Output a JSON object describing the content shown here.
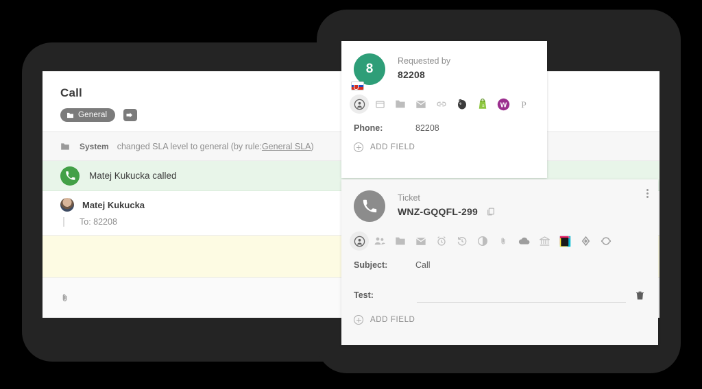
{
  "back_window": {
    "title": "Call",
    "tag": {
      "label": "General",
      "icon": "folder-icon"
    },
    "add_tag_icon": "add-tag-icon",
    "rows": {
      "system": {
        "icon": "note-icon",
        "who": "System",
        "text": "changed SLA level to general (by rule: ",
        "link": "General SLA",
        "text_end": ")"
      },
      "called": {
        "icon": "phone-icon",
        "text": "Matej Kukucka called"
      },
      "message": {
        "avatar": "user-avatar",
        "name": "Matej Kukucka",
        "to": "To: 82208"
      },
      "footer": {
        "icon": "paperclip-icon"
      }
    }
  },
  "requester_card": {
    "avatar": {
      "initial": "8",
      "color": "#2e9e78",
      "flag": "slovakia-flag-badge"
    },
    "label": "Requested by",
    "value": "82208",
    "icons": [
      {
        "name": "contact-icon",
        "active": true
      },
      {
        "name": "window-icon",
        "active": false
      },
      {
        "name": "folder-icon",
        "active": false
      },
      {
        "name": "envelope-icon",
        "active": false
      },
      {
        "name": "link-icon",
        "active": false
      },
      {
        "name": "mailchimp-icon",
        "active": false
      },
      {
        "name": "shopify-icon",
        "active": false
      },
      {
        "name": "woocommerce-icon",
        "active": false
      },
      {
        "name": "paypal-icon",
        "active": false
      }
    ],
    "fields": [
      {
        "key": "Phone:",
        "value": "82208"
      }
    ],
    "add_field": "ADD FIELD"
  },
  "ticket_card": {
    "avatar_icon": "phone-icon",
    "label": "Ticket",
    "id": "WNZ-GQQFL-299",
    "copy_icon": "copy-icon",
    "kebab_icon": "more-vertical-icon",
    "icons": [
      {
        "name": "contact-icon",
        "active": true
      },
      {
        "name": "group-icon",
        "active": false
      },
      {
        "name": "folder-icon",
        "active": false
      },
      {
        "name": "envelope-icon",
        "active": false
      },
      {
        "name": "alarm-icon",
        "active": false
      },
      {
        "name": "history-icon",
        "active": false
      },
      {
        "name": "clock-icon",
        "active": false
      },
      {
        "name": "paperclip-icon",
        "active": false
      },
      {
        "name": "cloud-icon",
        "active": false
      },
      {
        "name": "bank-icon",
        "active": false
      },
      {
        "name": "color-swatch-icon",
        "active": false
      },
      {
        "name": "diamond-icon",
        "active": false
      },
      {
        "name": "sync-icon",
        "active": false
      }
    ],
    "fields": [
      {
        "key": "Subject:",
        "value": "Call",
        "editable": false
      },
      {
        "key": "Test:",
        "value": "",
        "editable": true
      }
    ],
    "delete_icon": "trash-icon",
    "add_field": "ADD FIELD"
  },
  "colors": {
    "frame": "#242424",
    "accent_green": "#43a047",
    "avatar_green": "#2e9e78",
    "called_row": "#e8f5e9",
    "yellow_band": "#fdfbe3",
    "card_gray": "#f7f7f7"
  }
}
